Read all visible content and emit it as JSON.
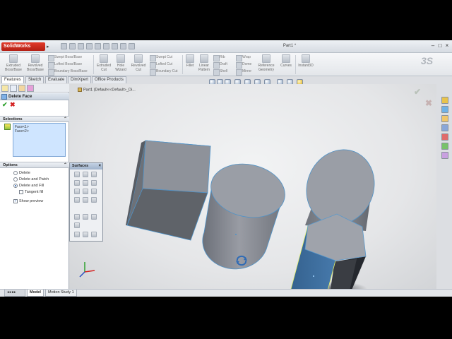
{
  "app": {
    "logo_text": "SolidWorks",
    "doc_title": "Part1 *"
  },
  "ribbon": {
    "extruded_boss": "Extruded\nBoss/Base",
    "revolved_boss": "Revolved\nBoss/Base",
    "swept_boss": "Swept Boss/Base",
    "lofted_boss": "Lofted Boss/Base",
    "boundary_boss": "Boundary Boss/Base",
    "extruded_cut": "Extruded\nCut",
    "hole_wizard": "Hole\nWizard",
    "revolved_cut": "Revolved\nCut",
    "swept_cut": "Swept Cut",
    "lofted_cut": "Lofted Cut",
    "boundary_cut": "Boundary Cut",
    "fillet": "Fillet",
    "linear_pattern": "Linear\nPattern",
    "rib": "Rib",
    "draft": "Draft",
    "shell": "Shell",
    "wrap": "Wrap",
    "dome": "Dome",
    "mirror": "Mirror",
    "reference_geometry": "Reference\nGeometry",
    "curves": "Curves",
    "instant3d": "Instant3D"
  },
  "tabs": [
    "Features",
    "Sketch",
    "Evaluate",
    "DimXpert",
    "Office Products"
  ],
  "tree_root": "Part1  (Default<<Default>_Di...",
  "property_manager": {
    "title": "Delete Face",
    "selections_label": "Selections",
    "faces": [
      "Face<1>",
      "Face<2>"
    ],
    "options_label": "Options",
    "options": [
      {
        "label": "Delete",
        "checked": false
      },
      {
        "label": "Delete and Patch",
        "checked": false
      },
      {
        "label": "Delete and Fill",
        "checked": true
      }
    ],
    "tangent_fill": {
      "label": "Tangent fill",
      "checked": false
    },
    "show_preview": {
      "label": "Show preview",
      "checked": true
    }
  },
  "surfaces_toolbar": {
    "title": "Surfaces"
  },
  "bottom_tabs": [
    "Model",
    "Motion Study 1"
  ],
  "colors": {
    "selected_face": "#3f6e9c",
    "body": "#8c9099",
    "accent_red": "#d42020",
    "accent_green": "#2fa12f"
  }
}
